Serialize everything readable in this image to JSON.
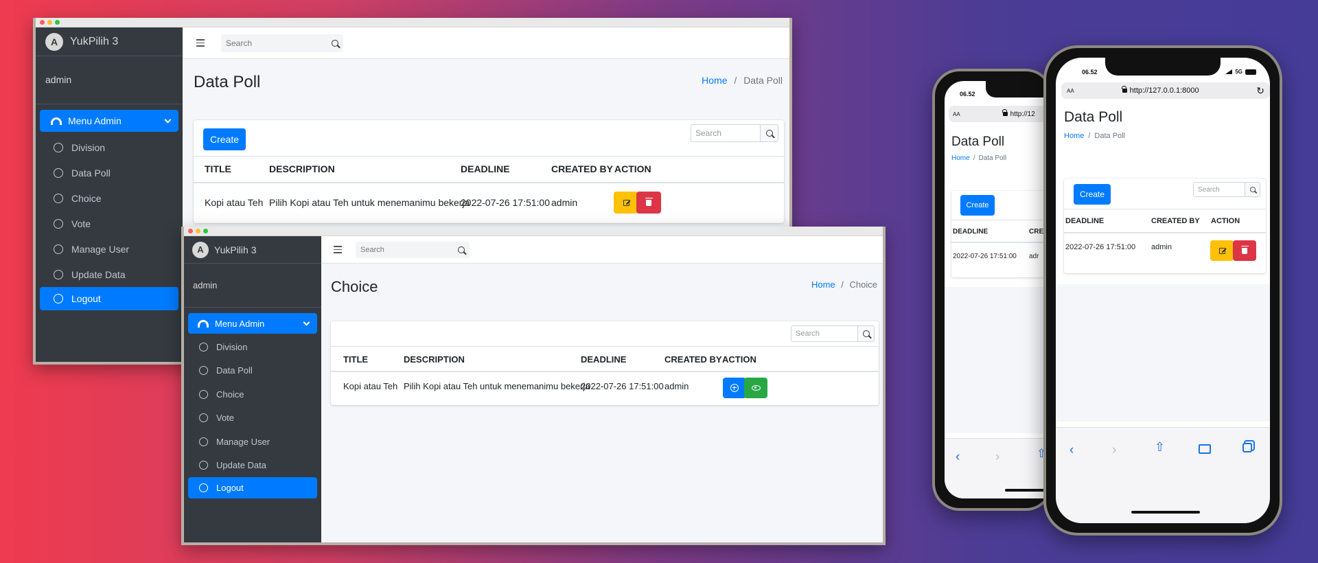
{
  "app": {
    "brand": "YukPilih 3",
    "user": "admin",
    "menu_header": "Menu Admin",
    "menu_items": [
      "Division",
      "Data Poll",
      "Choice",
      "Vote",
      "Manage User",
      "Update Data",
      "Logout"
    ],
    "search_placeholder": "Search"
  },
  "window1": {
    "page_title": "Data Poll",
    "breadcrumb_home": "Home",
    "breadcrumb_sep": "/",
    "breadcrumb_current": "Data Poll",
    "create_label": "Create",
    "table_search_placeholder": "Search",
    "columns": [
      "TITLE",
      "DESCRIPTION",
      "DEADLINE",
      "CREATED BY",
      "ACTION"
    ],
    "rows": [
      {
        "title": "Kopi atau Teh",
        "description": "Pilih Kopi atau Teh untuk menemanimu bekerja",
        "deadline": "2022-07-26 17:51:00",
        "created_by": "admin"
      }
    ]
  },
  "window2": {
    "page_title": "Choice",
    "breadcrumb_home": "Home",
    "breadcrumb_sep": "/",
    "breadcrumb_current": "Choice",
    "table_search_placeholder": "Search",
    "columns": [
      "TITLE",
      "DESCRIPTION",
      "DEADLINE",
      "CREATED BY",
      "ACTION"
    ],
    "rows": [
      {
        "title": "Kopi atau Teh",
        "description": "Pilih Kopi atau Teh untuk menemanimu bekerja",
        "deadline": "2022-07-26 17:51:00",
        "created_by": "admin"
      }
    ]
  },
  "phone_back": {
    "time": "06.52",
    "aa": "AA",
    "url": "http://12",
    "page_title": "Data Poll",
    "breadcrumb_home": "Home",
    "breadcrumb_current": "Data Poll",
    "create_label": "Create",
    "columns": [
      "DEADLINE",
      "CRE"
    ],
    "deadline": "2022-07-26 17:51:00",
    "created_by": "adr"
  },
  "phone_front": {
    "time": "06.52",
    "signal": "5G",
    "aa": "AA",
    "url": "http://127.0.0.1:8000",
    "page_title": "Data Poll",
    "breadcrumb_home": "Home",
    "breadcrumb_sep": "/",
    "breadcrumb_current": "Data Poll",
    "create_label": "Create",
    "table_search_placeholder": "Search",
    "columns": [
      "DEADLINE",
      "CREATED BY",
      "ACTION"
    ],
    "deadline": "2022-07-26 17:51:00",
    "created_by": "admin"
  },
  "colors": {
    "primary": "#007bff",
    "warning": "#ffc107",
    "danger": "#dc3545",
    "success": "#28a745",
    "sidebar": "#343a40"
  }
}
